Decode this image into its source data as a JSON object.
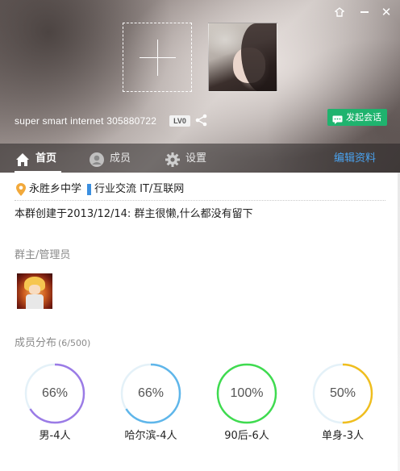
{
  "window": {
    "skin_icon": "skin-icon",
    "min_icon": "minimize-icon",
    "close_icon": "close-icon",
    "close_glyph": "✕"
  },
  "header": {
    "group_name": "super smart internet 305880722",
    "level": "LV0",
    "start_chat_label": "发起会话",
    "accent": "#1fb36e"
  },
  "nav": {
    "tabs": [
      {
        "label": "首页",
        "icon": "home-icon",
        "active": true
      },
      {
        "label": "成员",
        "icon": "user-icon",
        "active": false
      },
      {
        "label": "设置",
        "icon": "gear-icon",
        "active": false
      }
    ],
    "edit_label": "编辑资料",
    "edit_color": "#4aa3f0"
  },
  "info": {
    "location": "永胜乡中学",
    "industry": "行业交流  IT/互联网",
    "created": "本群创建于2013/12/14:  群主很懒,什么都没有留下"
  },
  "admins": {
    "title": "群主/管理员"
  },
  "distribution": {
    "title": "成员分布",
    "count": "(6/500)",
    "items": [
      {
        "percent_text": "66%",
        "label": "男-4人",
        "fraction": 0.66,
        "color": "#9b7be6"
      },
      {
        "percent_text": "66%",
        "label": "哈尔滨-4人",
        "fraction": 0.66,
        "color": "#5fb6ea"
      },
      {
        "percent_text": "100%",
        "label": "90后-6人",
        "fraction": 1.0,
        "color": "#3fdb4f"
      },
      {
        "percent_text": "50%",
        "label": "单身-3人",
        "fraction": 0.5,
        "color": "#f0be1e"
      }
    ],
    "track_color": "#e4f1f8"
  }
}
